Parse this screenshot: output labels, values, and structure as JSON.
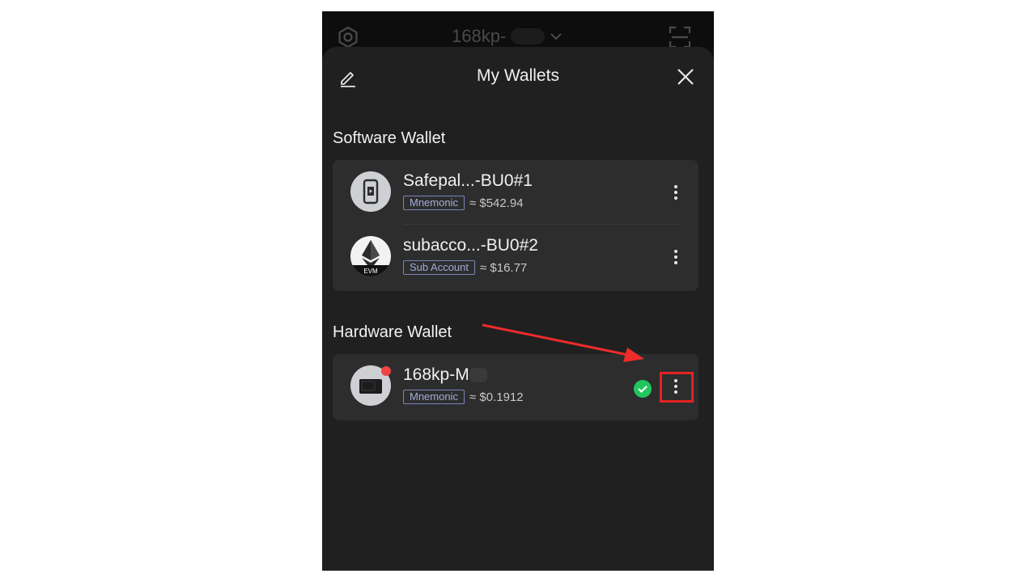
{
  "topbar": {
    "wallet_title": "168kp-",
    "settings_icon": "gear-icon",
    "scan_icon": "scan-icon"
  },
  "sheet": {
    "title": "My Wallets"
  },
  "software_section": {
    "label": "Software Wallet",
    "wallets": [
      {
        "name": "Safepal...-BU0#1",
        "tag": "Mnemonic",
        "balance": "≈ $542.94",
        "icon": "phone-icon"
      },
      {
        "name": "subacco...-BU0#2",
        "tag": "Sub Account",
        "balance": "≈ $16.77",
        "icon": "evm-icon",
        "icon_label": "EVM"
      }
    ]
  },
  "hardware_section": {
    "label": "Hardware Wallet",
    "wallets": [
      {
        "name": "168kp-M",
        "tag": "Mnemonic",
        "balance": "≈ $0.1912",
        "icon": "card-icon",
        "connected": true
      }
    ]
  },
  "colors": {
    "background": "#ffffff",
    "sheet": "#202020",
    "card": "#2d2d2e",
    "tag_border": "#7b84b9",
    "connected": "#22c55e",
    "highlight": "#e52222"
  }
}
